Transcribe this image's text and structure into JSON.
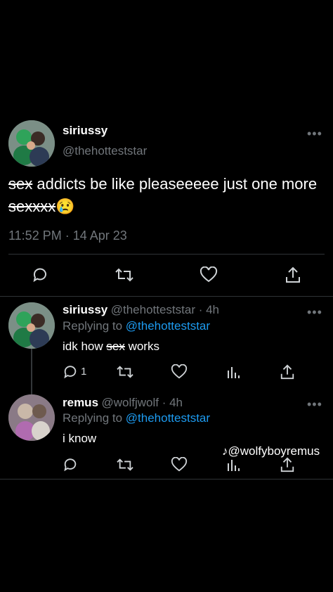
{
  "main_tweet": {
    "author_name": "siriussy",
    "author_handle": "@thehotteststar",
    "text_struck_1": "sex",
    "text_mid": " addicts be like pleaseeeee just one more ",
    "text_struck_2": "sexxxx",
    "emoji": "😢",
    "timestamp": "11:52 PM · 14 Apr 23",
    "more": "•••"
  },
  "reply_1": {
    "author_name": "siriussy",
    "meta": "@thehotteststar · 4h",
    "replying_prefix": "Replying to ",
    "replying_handle": "@thehotteststar",
    "text_pre": "idk how ",
    "text_struck": "sex",
    "text_post": " works",
    "reply_count": "1",
    "more": "•••"
  },
  "reply_2": {
    "author_name": "remus",
    "meta": "@wolfjwolf · 4h",
    "replying_prefix": "Replying to ",
    "replying_handle": "@thehotteststar",
    "text": "i know",
    "more": "•••"
  },
  "watermark": {
    "logo": "♪",
    "text": "@wolfyboyremus"
  },
  "colors": {
    "background": "#000000",
    "text": "#e7e9ea",
    "secondary": "#71767b",
    "link": "#1d9bf0",
    "divider": "#2f3336"
  }
}
